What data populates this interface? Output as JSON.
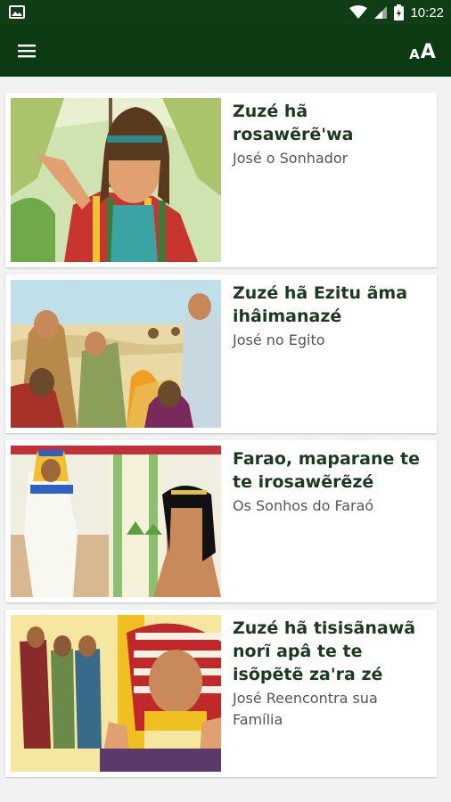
{
  "status_bar": {
    "time": "10:22",
    "icons": [
      "image-icon",
      "wifi-icon",
      "signal-icon",
      "battery-icon"
    ]
  },
  "app_bar": {
    "menu_icon": "hamburger-menu-icon",
    "font_size_icon": "font-size-icon",
    "font_size_small": "A",
    "font_size_large": "A"
  },
  "stories": [
    {
      "title": "Zuzé hã rosawẽrẽ'wa",
      "subtitle": "José o Sonhador"
    },
    {
      "title": "Zuzé hã Ezitu ãma ihâimanazé",
      "subtitle": "José no Egito"
    },
    {
      "title": "Farao, maparane te te irosawẽrẽzé",
      "subtitle": "Os Sonhos do Faraó"
    },
    {
      "title": "Zuzé hã tisisãnawã norĩ apâ te te isõpẽtẽ za'ra zé",
      "subtitle": "José Reencontra sua Família"
    }
  ],
  "colors": {
    "app_bar": "#0c3a13",
    "status_bar": "#0f3d16",
    "title_text": "#1b3a1f",
    "subtitle_text": "#555555",
    "background": "#f2f2f2"
  }
}
